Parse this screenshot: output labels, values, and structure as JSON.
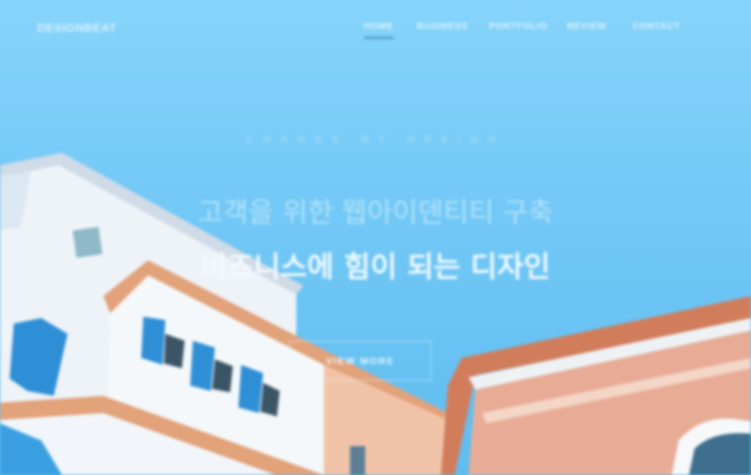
{
  "header": {
    "logo": "DESIGNBEAT",
    "nav": [
      {
        "label": "HOME",
        "active": true
      },
      {
        "label": "BUSINESS",
        "active": false
      },
      {
        "label": "PORTFOLIO",
        "active": false
      },
      {
        "label": "REVIEW",
        "active": false
      },
      {
        "label": "CONTACT",
        "active": false
      }
    ]
  },
  "hero": {
    "eyebrow": "CHANGE BY DESIGN",
    "title_line1": "고객을 위한 웹아이덴티티 구축",
    "title_line2": "비즈니스에 힘이 되는 디자인",
    "cta_label": "VIEW MORE"
  },
  "colors": {
    "sky_top": "#86d4fb",
    "sky_bottom": "#5fbdf0",
    "shutter_blue": "#2f8fd6",
    "roof_terracotta": "#d78a6a",
    "wall_white": "#f3f7fb",
    "wall_peach": "#e6a993"
  }
}
